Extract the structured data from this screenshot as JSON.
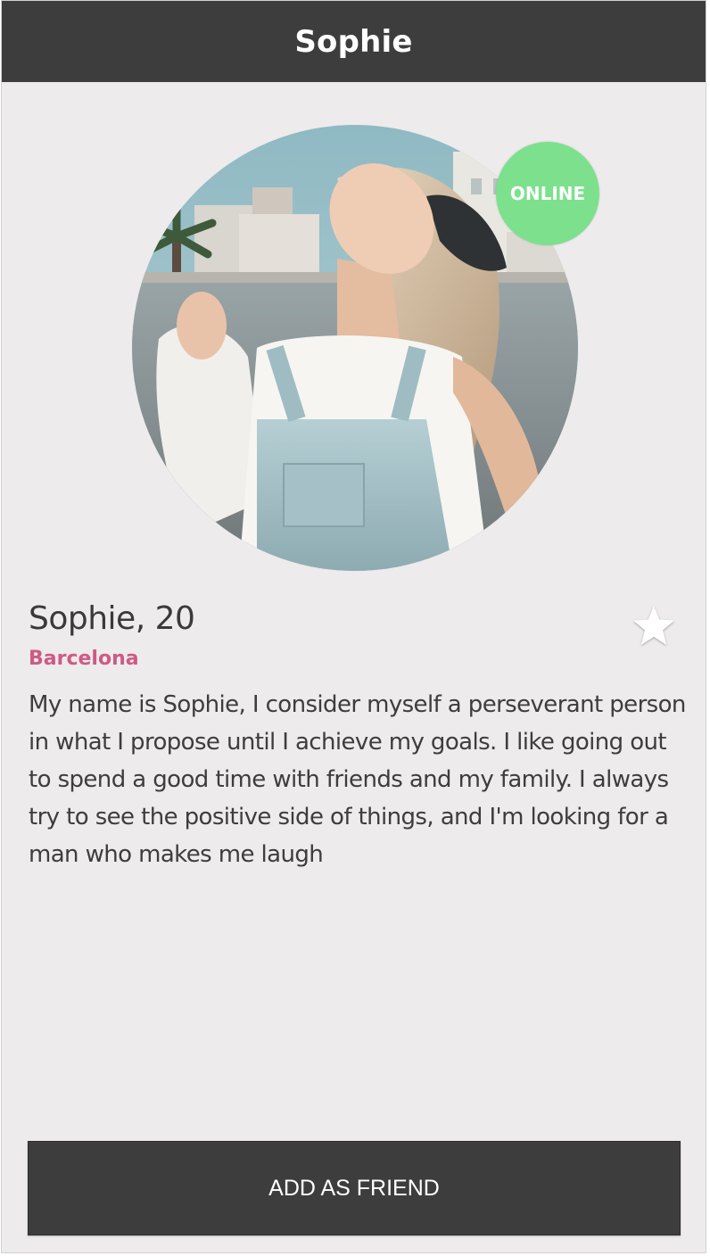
{
  "header": {
    "title": "Sophie"
  },
  "profile": {
    "status_badge": "ONLINE",
    "name_age": "Sophie, 20",
    "location": "Barcelona",
    "bio": "My name is Sophie, I consider myself a perseverant person in what I propose until I achieve my goals. I like going out to spend a good time with friends and my family. I always try to see the positive side of things, and I'm looking for a man who makes me laugh",
    "favorite_icon": "star-icon"
  },
  "actions": {
    "add_friend_label": "ADD AS FRIEND"
  },
  "colors": {
    "header_bg": "#3d3d3d",
    "page_bg": "#edebec",
    "online_green": "#7de08d",
    "location_pink": "#cd5b84",
    "text_dark": "#3d3d3d"
  }
}
